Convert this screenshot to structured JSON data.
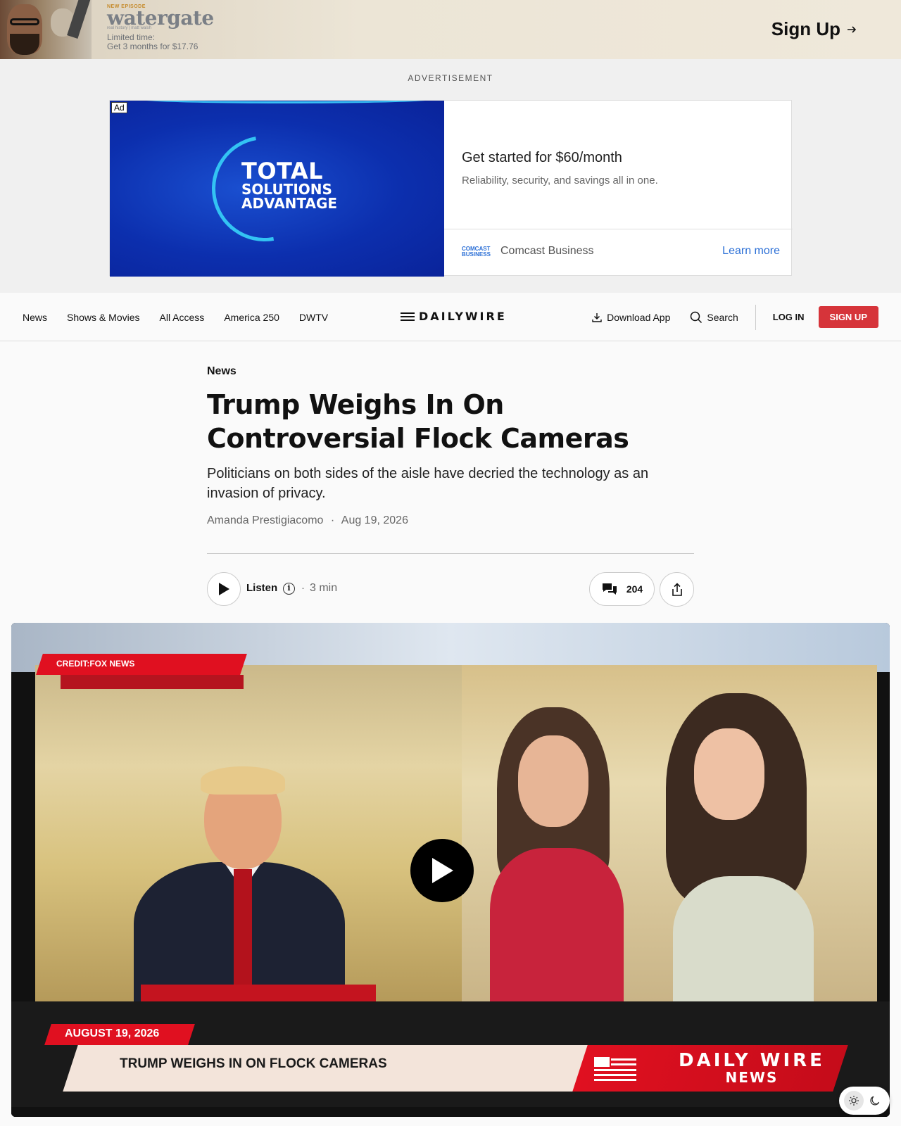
{
  "top_banner": {
    "new_episode": "NEW EPISODE",
    "title": "watergate",
    "subtitle": "real history | matt walsh",
    "offer_line1": "Limited time:",
    "offer_line2": "Get 3 months for $17.76",
    "cta": "Sign Up",
    "cta_icon": "arrow-right-icon"
  },
  "ad": {
    "label": "ADVERTISEMENT",
    "badge": "Ad",
    "visual_line1": "TOTAL",
    "visual_line2": "SOLUTIONS",
    "visual_line3": "ADVANTAGE",
    "headline": "Get started for $60/month",
    "description": "Reliability, security, and savings all in one.",
    "advertiser_logo_line1": "COMCAST",
    "advertiser_logo_line2": "BUSINESS",
    "advertiser": "Comcast Business",
    "cta": "Learn more"
  },
  "nav": {
    "links": [
      "News",
      "Shows & Movies",
      "All Access",
      "America 250",
      "DWTV"
    ],
    "logo": "DAILYWIRE",
    "download": "Download App",
    "search": "Search",
    "login": "LOG IN",
    "signup": "SIGN UP"
  },
  "article": {
    "category": "News",
    "headline": "Trump Weighs In On Controversial Flock Cameras",
    "dek": "Politicians on both sides of the aisle have decried the technology as an invasion of privacy.",
    "author": "Amanda Prestigiacomo",
    "separator": "·",
    "date": "Aug 19, 2026",
    "listen_label": "Listen",
    "duration": "3 min",
    "comment_count": "204"
  },
  "video": {
    "credit": "CREDIT:FOX NEWS",
    "lower_third_date": "AUGUST 19, 2026",
    "lower_third_headline": "TRUMP WEIGHS IN ON FLOCK CAMERAS",
    "brand_line1": "DAILY WIRE",
    "brand_line2": "NEWS",
    "accent": "#e01020"
  },
  "theme_toggle": {
    "options": [
      "sun-icon",
      "moon-icon"
    ],
    "active": "sun-icon"
  },
  "colors": {
    "brand_red": "#d6343a",
    "link_blue": "#2b6fd6"
  }
}
